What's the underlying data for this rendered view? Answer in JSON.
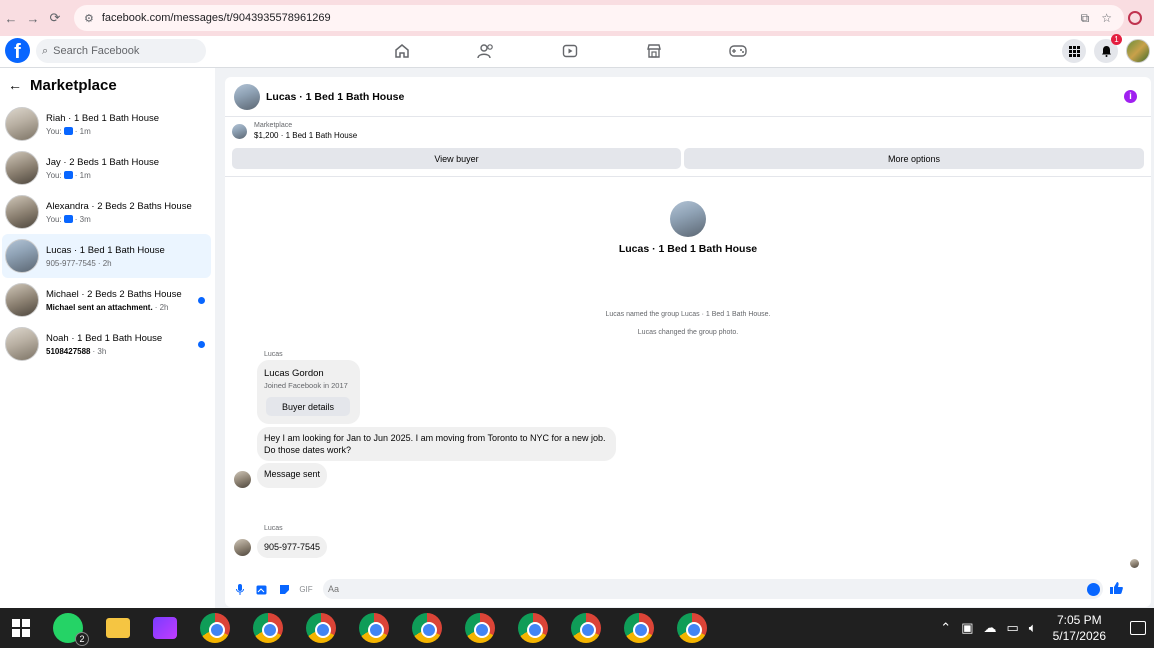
{
  "browser": {
    "url": "facebook.com/messages/t/9043935578961269"
  },
  "topbar": {
    "search_placeholder": "Search Facebook",
    "notification_count": "1"
  },
  "sidebar": {
    "title": "Marketplace",
    "conversations": [
      {
        "name": "Riah · 1 Bed 1 Bath House",
        "sub_prefix": "You:",
        "time": "· 1m",
        "unread": false
      },
      {
        "name": "Jay · 2 Beds 1 Bath House",
        "sub_prefix": "You:",
        "time": "· 1m",
        "unread": false
      },
      {
        "name": "Alexandra · 2 Beds 2 Baths House",
        "sub_prefix": "You:",
        "time": "· 3m",
        "unread": false
      },
      {
        "name": "Lucas · 1 Bed 1 Bath House",
        "sub_prefix": "905-977-7545",
        "time": "· 2h",
        "unread": false
      },
      {
        "name": "Michael · 2 Beds 2 Baths House",
        "sub_prefix": "Michael sent an attachment.",
        "time": "· 2h",
        "unread": true
      },
      {
        "name": "Noah · 1 Bed 1 Bath House",
        "sub_prefix": "5108427588",
        "time": "· 3h",
        "unread": true
      }
    ]
  },
  "chat": {
    "title": "Lucas · 1 Bed 1 Bath House",
    "marketplace_label": "Marketplace",
    "listing": "$1,200 · 1 Bed 1 Bath House",
    "view_buyer": "View buyer",
    "more_options": "More options",
    "center_title": "Lucas · 1 Bed 1 Bath House",
    "sys1": "Lucas named the group Lucas · 1 Bed 1 Bath House.",
    "sys2": "Lucas changed the group photo.",
    "sender1": "Lucas",
    "buyer_name": "Lucas Gordon",
    "buyer_meta": "Joined Facebook in 2017",
    "buyer_details": "Buyer details",
    "msg1": "Hey I am looking for Jan to Jun 2025. I am moving from Toronto to NYC for a new job. Do those dates work?",
    "msg2": "Message sent",
    "sender2": "Lucas",
    "msg3": "905-977-7545",
    "composer_placeholder": "Aa"
  },
  "taskbar": {
    "whatsapp_badge": "2",
    "time": "7:05 PM",
    "date": "5/17/2026"
  },
  "colors": {
    "accent": "#0866ff",
    "unread": "#0866ff",
    "info": "#a020f0"
  }
}
